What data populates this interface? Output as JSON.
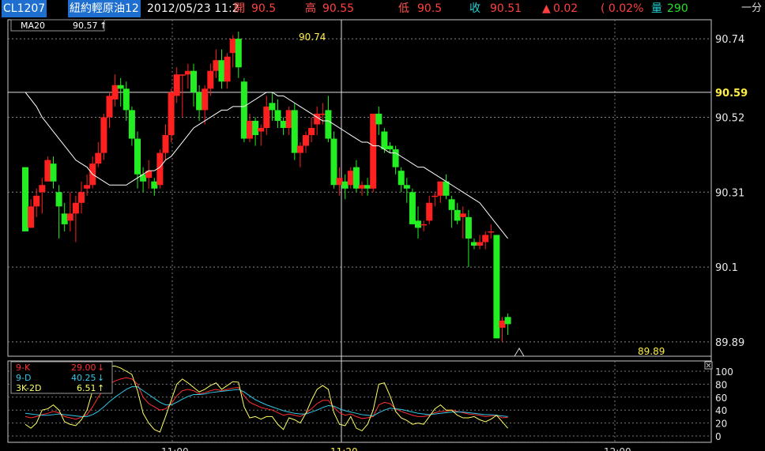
{
  "header": {
    "symbol": "CL1207",
    "name": "紐約輕原油12",
    "datetime": "2012/05/23 11:2",
    "open_label": "開",
    "open_value": "90.5",
    "high_label": "高",
    "high_value": "90.55",
    "low_label": "低",
    "low_value": "90.5",
    "close_label": "收",
    "close_value": "90.51",
    "change_icon": "up-triangle-icon",
    "change_value": "0.02",
    "change_pct": "( 0.02%",
    "volume_label": "量",
    "volume_value": "290",
    "period": "一分"
  },
  "main_chart": {
    "ma_label": "MA20",
    "ma_value": "90.57",
    "ma_arrow": "↑",
    "price_ticks": [
      "90.74",
      "90.52",
      "90.31",
      "90.1",
      "89.89"
    ],
    "current_price_label": "90.59",
    "high_marker": "90.74",
    "low_marker": "89.89"
  },
  "kd_panel": {
    "k_label": "9-K",
    "k_value": "29.00",
    "k_arrow": "↓",
    "d_label": "9-D",
    "d_value": "40.25",
    "d_arrow": "↓",
    "diff_label": "3K-2D",
    "diff_value": "6.51",
    "diff_arrow": "↑",
    "ticks": [
      "100",
      "80",
      "60",
      "40",
      "20",
      "0"
    ],
    "close_icon": "close-icon"
  },
  "time_axis": [
    "11:00",
    "11:20",
    "12:00"
  ],
  "colors": {
    "up": "#ff2020",
    "down": "#22ee22",
    "ma": "#ffffff",
    "k": "#ff3030",
    "d": "#33c8e8",
    "j": "#ffff66",
    "price_label": "#ffee44"
  },
  "chart_data": [
    {
      "type": "candlestick",
      "ylim": [
        89.85,
        90.8
      ],
      "y_ticks": [
        90.74,
        90.52,
        90.31,
        90.1,
        89.89
      ],
      "ohlc": [
        [
          90.38,
          90.38,
          90.2,
          90.2
        ],
        [
          90.21,
          90.29,
          90.21,
          90.27
        ],
        [
          90.27,
          90.32,
          90.24,
          90.3
        ],
        [
          90.31,
          90.35,
          90.25,
          90.33
        ],
        [
          90.34,
          90.41,
          90.34,
          90.4
        ],
        [
          90.39,
          90.41,
          90.32,
          90.34
        ],
        [
          90.31,
          90.33,
          90.18,
          90.27
        ],
        [
          90.25,
          90.28,
          90.2,
          90.22
        ],
        [
          90.23,
          90.31,
          90.2,
          90.25
        ],
        [
          90.25,
          90.3,
          90.17,
          90.28
        ],
        [
          90.28,
          90.34,
          90.25,
          90.31
        ],
        [
          90.32,
          90.36,
          90.3,
          90.33
        ],
        [
          90.33,
          90.41,
          90.32,
          90.39
        ],
        [
          90.39,
          90.45,
          90.38,
          90.42
        ],
        [
          90.42,
          90.53,
          90.4,
          90.52
        ],
        [
          90.52,
          90.59,
          90.49,
          90.58
        ],
        [
          90.57,
          90.64,
          90.55,
          90.61
        ],
        [
          90.61,
          90.63,
          90.55,
          90.6
        ],
        [
          90.6,
          90.62,
          90.51,
          90.54
        ],
        [
          90.54,
          90.55,
          90.44,
          90.46
        ],
        [
          90.46,
          90.48,
          90.32,
          90.36
        ],
        [
          90.36,
          90.38,
          90.31,
          90.34
        ],
        [
          90.35,
          90.4,
          90.32,
          90.37
        ],
        [
          90.34,
          90.35,
          90.3,
          90.32
        ],
        [
          90.33,
          90.43,
          90.32,
          90.42
        ],
        [
          90.42,
          90.5,
          90.4,
          90.47
        ],
        [
          90.47,
          90.6,
          90.45,
          90.59
        ],
        [
          90.58,
          90.66,
          90.56,
          90.64
        ],
        [
          90.64,
          90.64,
          90.52,
          90.64
        ],
        [
          90.64,
          90.67,
          90.6,
          90.65
        ],
        [
          90.65,
          90.67,
          90.55,
          90.59
        ],
        [
          90.59,
          90.61,
          90.51,
          90.54
        ],
        [
          90.54,
          90.61,
          90.5,
          90.6
        ],
        [
          90.6,
          90.67,
          90.58,
          90.65
        ],
        [
          90.65,
          90.71,
          90.63,
          90.68
        ],
        [
          90.68,
          90.71,
          90.6,
          90.62
        ],
        [
          90.62,
          90.7,
          90.6,
          90.69
        ],
        [
          90.7,
          90.75,
          90.66,
          90.74
        ],
        [
          90.74,
          90.76,
          90.63,
          90.66
        ],
        [
          90.62,
          90.63,
          90.45,
          90.46
        ],
        [
          90.46,
          90.53,
          90.45,
          90.51
        ],
        [
          90.51,
          90.52,
          90.44,
          90.47
        ],
        [
          90.48,
          90.5,
          90.44,
          90.49
        ],
        [
          90.49,
          90.58,
          90.47,
          90.55
        ],
        [
          90.56,
          90.59,
          90.51,
          90.54
        ],
        [
          90.54,
          90.57,
          90.49,
          90.51
        ],
        [
          90.51,
          90.52,
          90.47,
          90.49
        ],
        [
          90.49,
          90.55,
          90.47,
          90.54
        ],
        [
          90.54,
          90.56,
          90.4,
          90.42
        ],
        [
          90.42,
          90.45,
          90.38,
          90.44
        ],
        [
          90.44,
          90.48,
          90.42,
          90.47
        ],
        [
          90.47,
          90.52,
          90.45,
          90.49
        ],
        [
          90.5,
          90.55,
          90.47,
          90.53
        ],
        [
          90.53,
          90.56,
          90.5,
          90.53
        ],
        [
          90.54,
          90.58,
          90.45,
          90.46
        ],
        [
          90.46,
          90.48,
          90.32,
          90.33
        ],
        [
          90.33,
          90.38,
          90.3,
          90.35
        ],
        [
          90.34,
          90.36,
          90.29,
          90.32
        ],
        [
          90.33,
          90.38,
          90.32,
          90.37
        ],
        [
          90.38,
          90.4,
          90.31,
          90.32
        ],
        [
          90.32,
          90.34,
          90.3,
          90.33
        ],
        [
          90.33,
          90.35,
          90.3,
          90.32
        ],
        [
          90.32,
          90.53,
          90.31,
          90.53
        ],
        [
          90.53,
          90.55,
          90.47,
          90.5
        ],
        [
          90.48,
          90.49,
          90.42,
          90.43
        ],
        [
          90.44,
          90.45,
          90.42,
          90.43
        ],
        [
          90.43,
          90.44,
          90.36,
          90.38
        ],
        [
          90.37,
          90.38,
          90.31,
          90.33
        ],
        [
          90.33,
          90.35,
          90.28,
          90.32
        ],
        [
          90.31,
          90.32,
          90.22,
          90.22
        ],
        [
          90.23,
          90.27,
          90.18,
          90.21
        ],
        [
          90.22,
          90.23,
          90.2,
          90.22
        ],
        [
          90.23,
          90.3,
          90.22,
          90.28
        ],
        [
          90.3,
          90.31,
          90.27,
          90.3
        ],
        [
          90.3,
          90.34,
          90.28,
          90.34
        ],
        [
          90.34,
          90.36,
          90.29,
          90.3
        ],
        [
          90.29,
          90.3,
          90.21,
          90.26
        ],
        [
          90.26,
          90.28,
          90.22,
          90.23
        ],
        [
          90.24,
          90.27,
          90.18,
          90.25
        ],
        [
          90.24,
          90.26,
          90.1,
          90.18
        ],
        [
          90.17,
          90.18,
          90.15,
          90.16
        ],
        [
          90.16,
          90.19,
          90.15,
          90.17
        ],
        [
          90.17,
          90.2,
          90.15,
          90.19
        ],
        [
          90.2,
          90.22,
          90.18,
          90.2
        ],
        [
          90.19,
          90.19,
          89.9,
          89.9
        ],
        [
          89.93,
          89.96,
          89.89,
          89.95
        ],
        [
          89.96,
          89.97,
          89.91,
          89.94
        ]
      ],
      "ma20": [
        90.59,
        90.57,
        90.55,
        90.52,
        90.5,
        90.48,
        90.46,
        90.44,
        90.42,
        90.4,
        90.39,
        90.38,
        90.36,
        90.35,
        90.34,
        90.33,
        90.33,
        90.33,
        90.33,
        90.34,
        90.35,
        90.36,
        90.37,
        90.37,
        90.38,
        90.4,
        90.41,
        90.43,
        90.45,
        90.47,
        90.49,
        90.5,
        90.51,
        90.52,
        90.53,
        90.54,
        90.54,
        90.55,
        90.55,
        90.55,
        90.56,
        90.57,
        90.58,
        90.59,
        90.59,
        90.58,
        90.58,
        90.57,
        90.56,
        90.55,
        90.54,
        90.53,
        90.52,
        90.51,
        90.51,
        90.5,
        90.49,
        90.48,
        90.47,
        90.46,
        90.45,
        90.45,
        90.44,
        90.44,
        90.43,
        90.42,
        90.42,
        90.41,
        90.4,
        90.39,
        90.38,
        90.38,
        90.37,
        90.36,
        90.35,
        90.34,
        90.33,
        90.32,
        90.31,
        90.3,
        90.29,
        90.28,
        90.26,
        90.24,
        90.22,
        90.2,
        90.18
      ]
    },
    {
      "type": "line",
      "ylim": [
        0,
        100
      ],
      "series": [
        {
          "name": "9-K",
          "values": [
            30,
            28,
            30,
            33,
            35,
            38,
            36,
            30,
            28,
            26,
            29,
            33,
            45,
            60,
            72,
            80,
            85,
            88,
            90,
            88,
            80,
            60,
            50,
            45,
            40,
            42,
            50,
            62,
            70,
            72,
            70,
            65,
            67,
            70,
            72,
            70,
            72,
            74,
            75,
            62,
            52,
            48,
            44,
            42,
            40,
            36,
            32,
            34,
            32,
            30,
            35,
            42,
            50,
            55,
            55,
            44,
            36,
            32,
            34,
            30,
            27,
            28,
            30,
            48,
            52,
            50,
            42,
            38,
            35,
            32,
            30,
            30,
            32,
            36,
            38,
            38,
            40,
            38,
            36,
            34,
            33,
            32,
            30,
            31,
            32,
            28,
            29
          ]
        },
        {
          "name": "9-D",
          "values": [
            35,
            34,
            33,
            32,
            32,
            33,
            34,
            33,
            32,
            31,
            30,
            30,
            33,
            38,
            45,
            53,
            60,
            66,
            72,
            76,
            76,
            70,
            64,
            58,
            52,
            48,
            48,
            52,
            57,
            61,
            64,
            64,
            65,
            67,
            68,
            69,
            70,
            71,
            72,
            68,
            62,
            56,
            52,
            48,
            45,
            42,
            39,
            37,
            35,
            34,
            34,
            37,
            40,
            44,
            47,
            46,
            42,
            39,
            37,
            35,
            33,
            32,
            31,
            36,
            40,
            43,
            42,
            41,
            39,
            37,
            35,
            34,
            33,
            34,
            35,
            36,
            37,
            37,
            37,
            36,
            35,
            34,
            33,
            33,
            32,
            31,
            30
          ]
        },
        {
          "name": "3K-2D",
          "values": [
            18,
            12,
            20,
            40,
            42,
            48,
            40,
            22,
            18,
            16,
            25,
            40,
            70,
            95,
            105,
            110,
            108,
            105,
            100,
            95,
            70,
            35,
            20,
            10,
            6,
            30,
            55,
            80,
            88,
            82,
            75,
            68,
            72,
            78,
            82,
            72,
            78,
            84,
            83,
            45,
            28,
            30,
            26,
            30,
            30,
            18,
            10,
            28,
            25,
            20,
            35,
            55,
            72,
            78,
            72,
            36,
            18,
            16,
            30,
            12,
            8,
            18,
            40,
            80,
            82,
            62,
            38,
            28,
            24,
            18,
            20,
            18,
            30,
            42,
            48,
            40,
            40,
            32,
            28,
            28,
            30,
            25,
            22,
            26,
            32,
            22,
            12
          ]
        }
      ]
    }
  ]
}
